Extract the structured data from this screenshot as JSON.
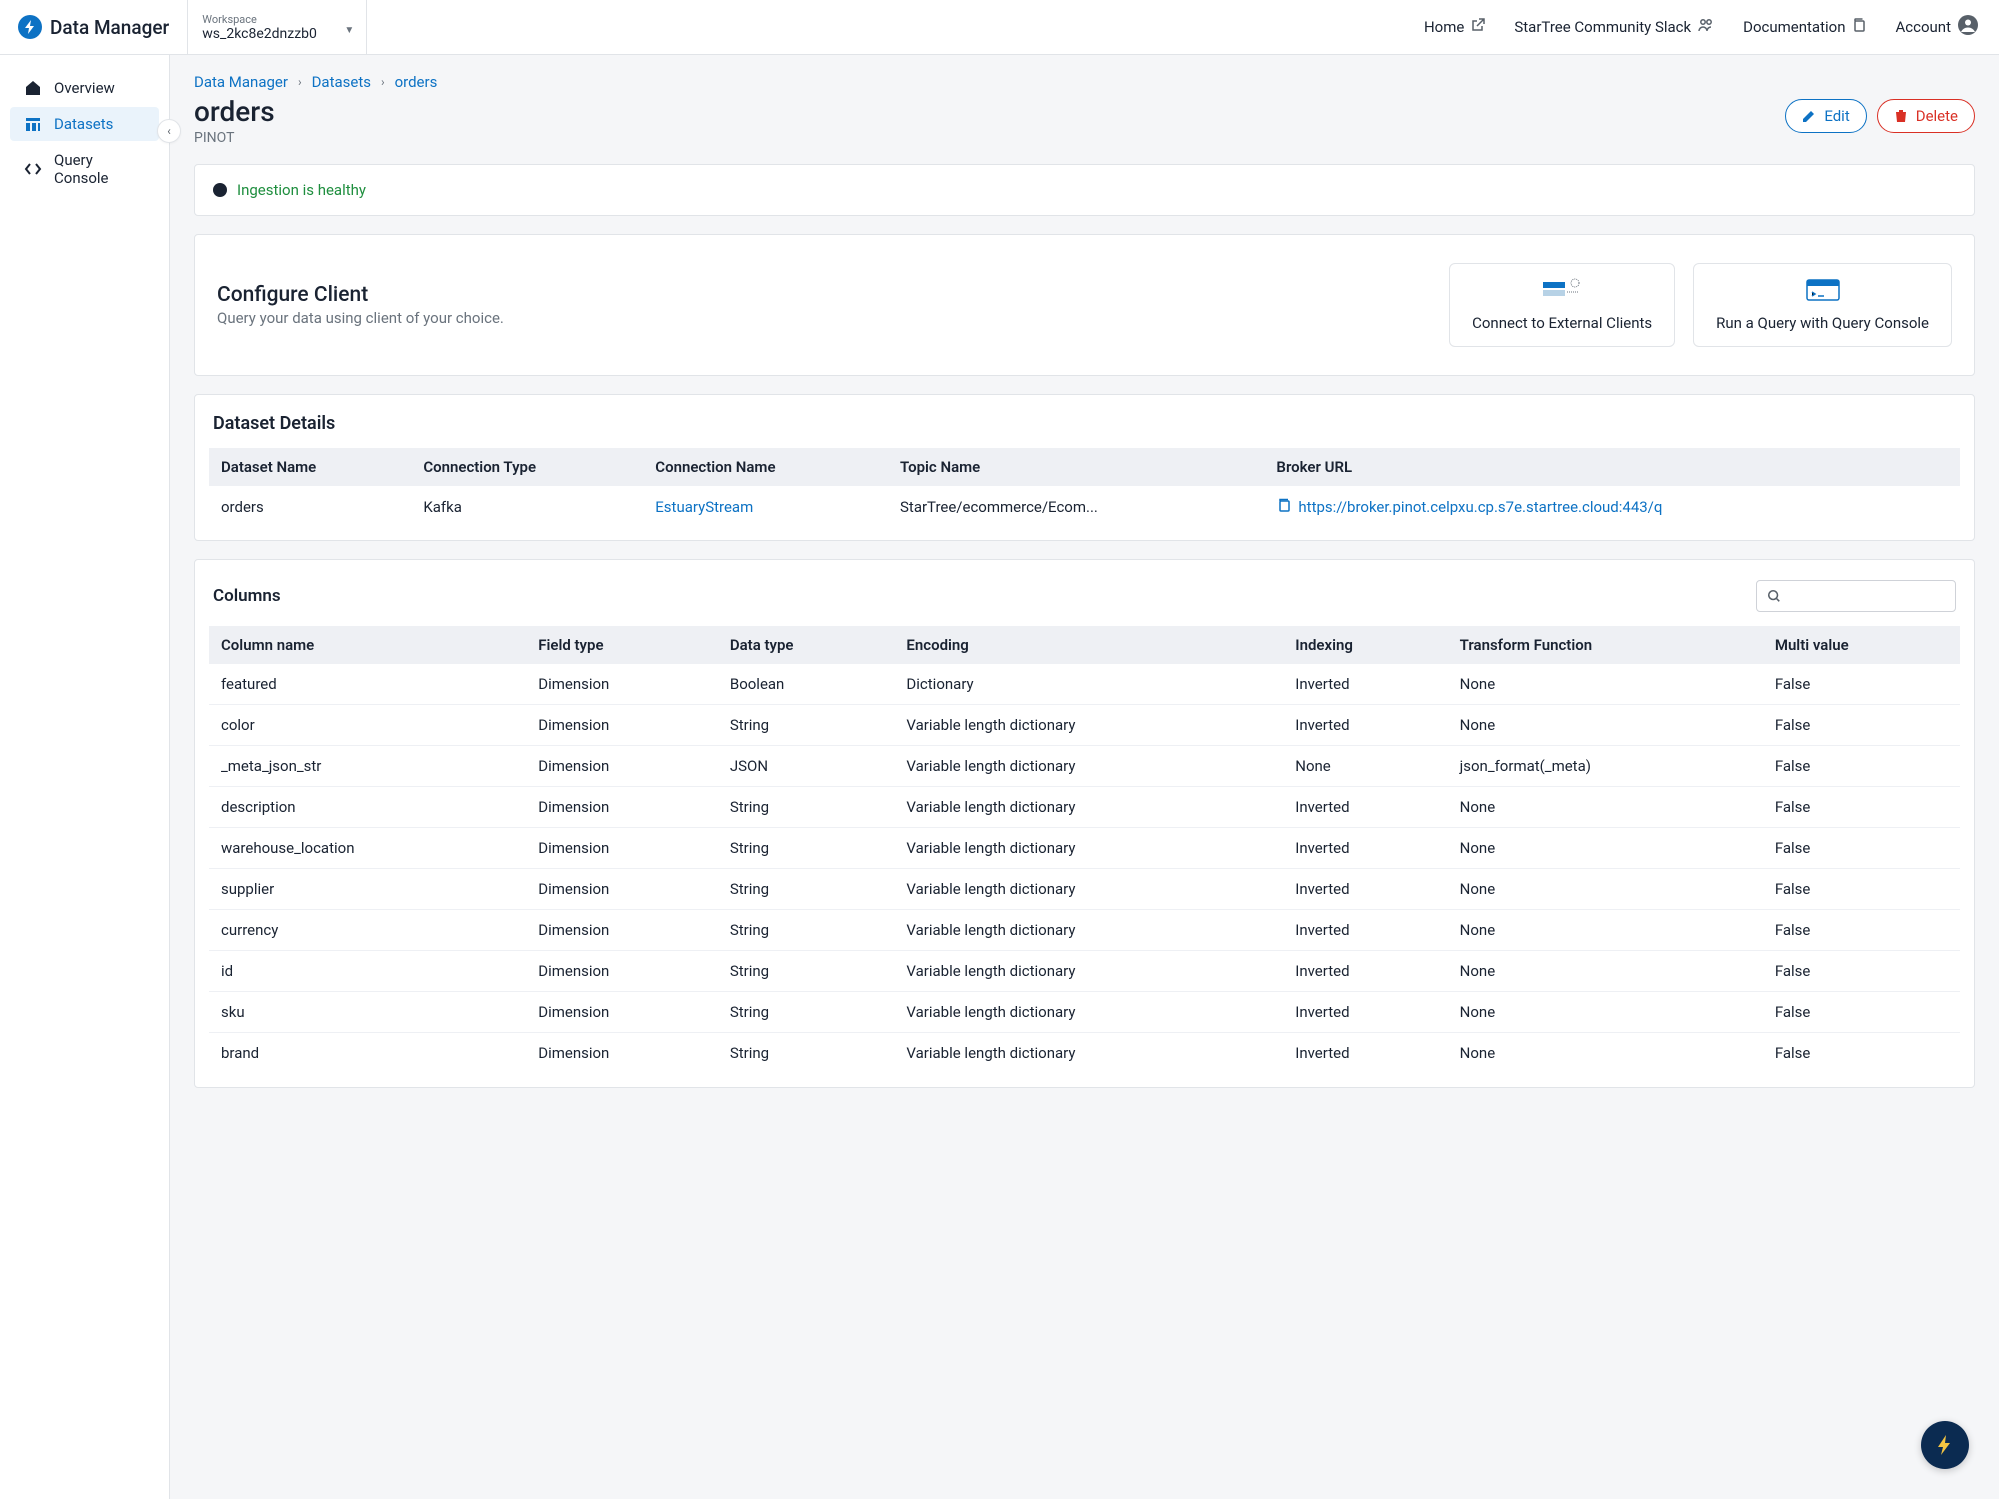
{
  "brand": "Data Manager",
  "workspace": {
    "label": "Workspace",
    "value": "ws_2kc8e2dnzzb0"
  },
  "topnav": {
    "home": "Home",
    "slack": "StarTree Community Slack",
    "docs": "Documentation",
    "account": "Account"
  },
  "sidebar": {
    "overview": "Overview",
    "datasets": "Datasets",
    "query_console": "Query Console"
  },
  "breadcrumb": {
    "root": "Data Manager",
    "mid": "Datasets",
    "leaf": "orders"
  },
  "page": {
    "title": "orders",
    "subtitle": "PINOT"
  },
  "actions": {
    "edit": "Edit",
    "delete": "Delete"
  },
  "status": {
    "text": "Ingestion is healthy"
  },
  "configure": {
    "title": "Configure Client",
    "subtitle": "Query your data using client of your choice.",
    "connect": "Connect to External Clients",
    "run_query": "Run a Query with Query Console"
  },
  "details": {
    "title": "Dataset Details",
    "headers": {
      "name": "Dataset Name",
      "conn_type": "Connection Type",
      "conn_name": "Connection Name",
      "topic": "Topic Name",
      "broker": "Broker URL"
    },
    "row": {
      "name": "orders",
      "conn_type": "Kafka",
      "conn_name": "EstuaryStream",
      "topic": "StarTree/ecommerce/Ecom...",
      "broker": "https://broker.pinot.celpxu.cp.s7e.startree.cloud:443/q"
    }
  },
  "columns": {
    "title": "Columns",
    "headers": {
      "name": "Column name",
      "field": "Field type",
      "data": "Data type",
      "enc": "Encoding",
      "idx": "Indexing",
      "transform": "Transform Function",
      "multi": "Multi value"
    },
    "rows": [
      {
        "name": "featured",
        "field": "Dimension",
        "data": "Boolean",
        "enc": "Dictionary",
        "idx": "Inverted",
        "transform": "None",
        "multi": "False"
      },
      {
        "name": "color",
        "field": "Dimension",
        "data": "String",
        "enc": "Variable length dictionary",
        "idx": "Inverted",
        "transform": "None",
        "multi": "False"
      },
      {
        "name": "_meta_json_str",
        "field": "Dimension",
        "data": "JSON",
        "enc": "Variable length dictionary",
        "idx": "None",
        "transform": "json_format(_meta)",
        "multi": "False"
      },
      {
        "name": "description",
        "field": "Dimension",
        "data": "String",
        "enc": "Variable length dictionary",
        "idx": "Inverted",
        "transform": "None",
        "multi": "False"
      },
      {
        "name": "warehouse_location",
        "field": "Dimension",
        "data": "String",
        "enc": "Variable length dictionary",
        "idx": "Inverted",
        "transform": "None",
        "multi": "False"
      },
      {
        "name": "supplier",
        "field": "Dimension",
        "data": "String",
        "enc": "Variable length dictionary",
        "idx": "Inverted",
        "transform": "None",
        "multi": "False"
      },
      {
        "name": "currency",
        "field": "Dimension",
        "data": "String",
        "enc": "Variable length dictionary",
        "idx": "Inverted",
        "transform": "None",
        "multi": "False"
      },
      {
        "name": "id",
        "field": "Dimension",
        "data": "String",
        "enc": "Variable length dictionary",
        "idx": "Inverted",
        "transform": "None",
        "multi": "False"
      },
      {
        "name": "sku",
        "field": "Dimension",
        "data": "String",
        "enc": "Variable length dictionary",
        "idx": "Inverted",
        "transform": "None",
        "multi": "False"
      },
      {
        "name": "brand",
        "field": "Dimension",
        "data": "String",
        "enc": "Variable length dictionary",
        "idx": "Inverted",
        "transform": "None",
        "multi": "False"
      }
    ]
  }
}
